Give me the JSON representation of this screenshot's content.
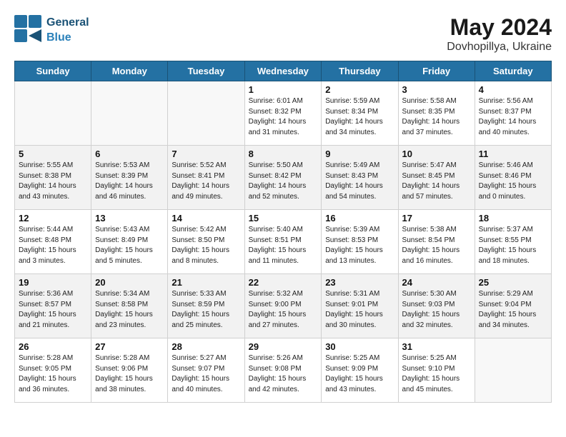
{
  "header": {
    "logo_text_general": "General",
    "logo_text_blue": "Blue",
    "month_year": "May 2024",
    "location": "Dovhopillya, Ukraine"
  },
  "weekdays": [
    "Sunday",
    "Monday",
    "Tuesday",
    "Wednesday",
    "Thursday",
    "Friday",
    "Saturday"
  ],
  "weeks": [
    [
      {
        "day": "",
        "info": ""
      },
      {
        "day": "",
        "info": ""
      },
      {
        "day": "",
        "info": ""
      },
      {
        "day": "1",
        "info": "Sunrise: 6:01 AM\nSunset: 8:32 PM\nDaylight: 14 hours\nand 31 minutes."
      },
      {
        "day": "2",
        "info": "Sunrise: 5:59 AM\nSunset: 8:34 PM\nDaylight: 14 hours\nand 34 minutes."
      },
      {
        "day": "3",
        "info": "Sunrise: 5:58 AM\nSunset: 8:35 PM\nDaylight: 14 hours\nand 37 minutes."
      },
      {
        "day": "4",
        "info": "Sunrise: 5:56 AM\nSunset: 8:37 PM\nDaylight: 14 hours\nand 40 minutes."
      }
    ],
    [
      {
        "day": "5",
        "info": "Sunrise: 5:55 AM\nSunset: 8:38 PM\nDaylight: 14 hours\nand 43 minutes."
      },
      {
        "day": "6",
        "info": "Sunrise: 5:53 AM\nSunset: 8:39 PM\nDaylight: 14 hours\nand 46 minutes."
      },
      {
        "day": "7",
        "info": "Sunrise: 5:52 AM\nSunset: 8:41 PM\nDaylight: 14 hours\nand 49 minutes."
      },
      {
        "day": "8",
        "info": "Sunrise: 5:50 AM\nSunset: 8:42 PM\nDaylight: 14 hours\nand 52 minutes."
      },
      {
        "day": "9",
        "info": "Sunrise: 5:49 AM\nSunset: 8:43 PM\nDaylight: 14 hours\nand 54 minutes."
      },
      {
        "day": "10",
        "info": "Sunrise: 5:47 AM\nSunset: 8:45 PM\nDaylight: 14 hours\nand 57 minutes."
      },
      {
        "day": "11",
        "info": "Sunrise: 5:46 AM\nSunset: 8:46 PM\nDaylight: 15 hours\nand 0 minutes."
      }
    ],
    [
      {
        "day": "12",
        "info": "Sunrise: 5:44 AM\nSunset: 8:48 PM\nDaylight: 15 hours\nand 3 minutes."
      },
      {
        "day": "13",
        "info": "Sunrise: 5:43 AM\nSunset: 8:49 PM\nDaylight: 15 hours\nand 5 minutes."
      },
      {
        "day": "14",
        "info": "Sunrise: 5:42 AM\nSunset: 8:50 PM\nDaylight: 15 hours\nand 8 minutes."
      },
      {
        "day": "15",
        "info": "Sunrise: 5:40 AM\nSunset: 8:51 PM\nDaylight: 15 hours\nand 11 minutes."
      },
      {
        "day": "16",
        "info": "Sunrise: 5:39 AM\nSunset: 8:53 PM\nDaylight: 15 hours\nand 13 minutes."
      },
      {
        "day": "17",
        "info": "Sunrise: 5:38 AM\nSunset: 8:54 PM\nDaylight: 15 hours\nand 16 minutes."
      },
      {
        "day": "18",
        "info": "Sunrise: 5:37 AM\nSunset: 8:55 PM\nDaylight: 15 hours\nand 18 minutes."
      }
    ],
    [
      {
        "day": "19",
        "info": "Sunrise: 5:36 AM\nSunset: 8:57 PM\nDaylight: 15 hours\nand 21 minutes."
      },
      {
        "day": "20",
        "info": "Sunrise: 5:34 AM\nSunset: 8:58 PM\nDaylight: 15 hours\nand 23 minutes."
      },
      {
        "day": "21",
        "info": "Sunrise: 5:33 AM\nSunset: 8:59 PM\nDaylight: 15 hours\nand 25 minutes."
      },
      {
        "day": "22",
        "info": "Sunrise: 5:32 AM\nSunset: 9:00 PM\nDaylight: 15 hours\nand 27 minutes."
      },
      {
        "day": "23",
        "info": "Sunrise: 5:31 AM\nSunset: 9:01 PM\nDaylight: 15 hours\nand 30 minutes."
      },
      {
        "day": "24",
        "info": "Sunrise: 5:30 AM\nSunset: 9:03 PM\nDaylight: 15 hours\nand 32 minutes."
      },
      {
        "day": "25",
        "info": "Sunrise: 5:29 AM\nSunset: 9:04 PM\nDaylight: 15 hours\nand 34 minutes."
      }
    ],
    [
      {
        "day": "26",
        "info": "Sunrise: 5:28 AM\nSunset: 9:05 PM\nDaylight: 15 hours\nand 36 minutes."
      },
      {
        "day": "27",
        "info": "Sunrise: 5:28 AM\nSunset: 9:06 PM\nDaylight: 15 hours\nand 38 minutes."
      },
      {
        "day": "28",
        "info": "Sunrise: 5:27 AM\nSunset: 9:07 PM\nDaylight: 15 hours\nand 40 minutes."
      },
      {
        "day": "29",
        "info": "Sunrise: 5:26 AM\nSunset: 9:08 PM\nDaylight: 15 hours\nand 42 minutes."
      },
      {
        "day": "30",
        "info": "Sunrise: 5:25 AM\nSunset: 9:09 PM\nDaylight: 15 hours\nand 43 minutes."
      },
      {
        "day": "31",
        "info": "Sunrise: 5:25 AM\nSunset: 9:10 PM\nDaylight: 15 hours\nand 45 minutes."
      },
      {
        "day": "",
        "info": ""
      }
    ]
  ]
}
